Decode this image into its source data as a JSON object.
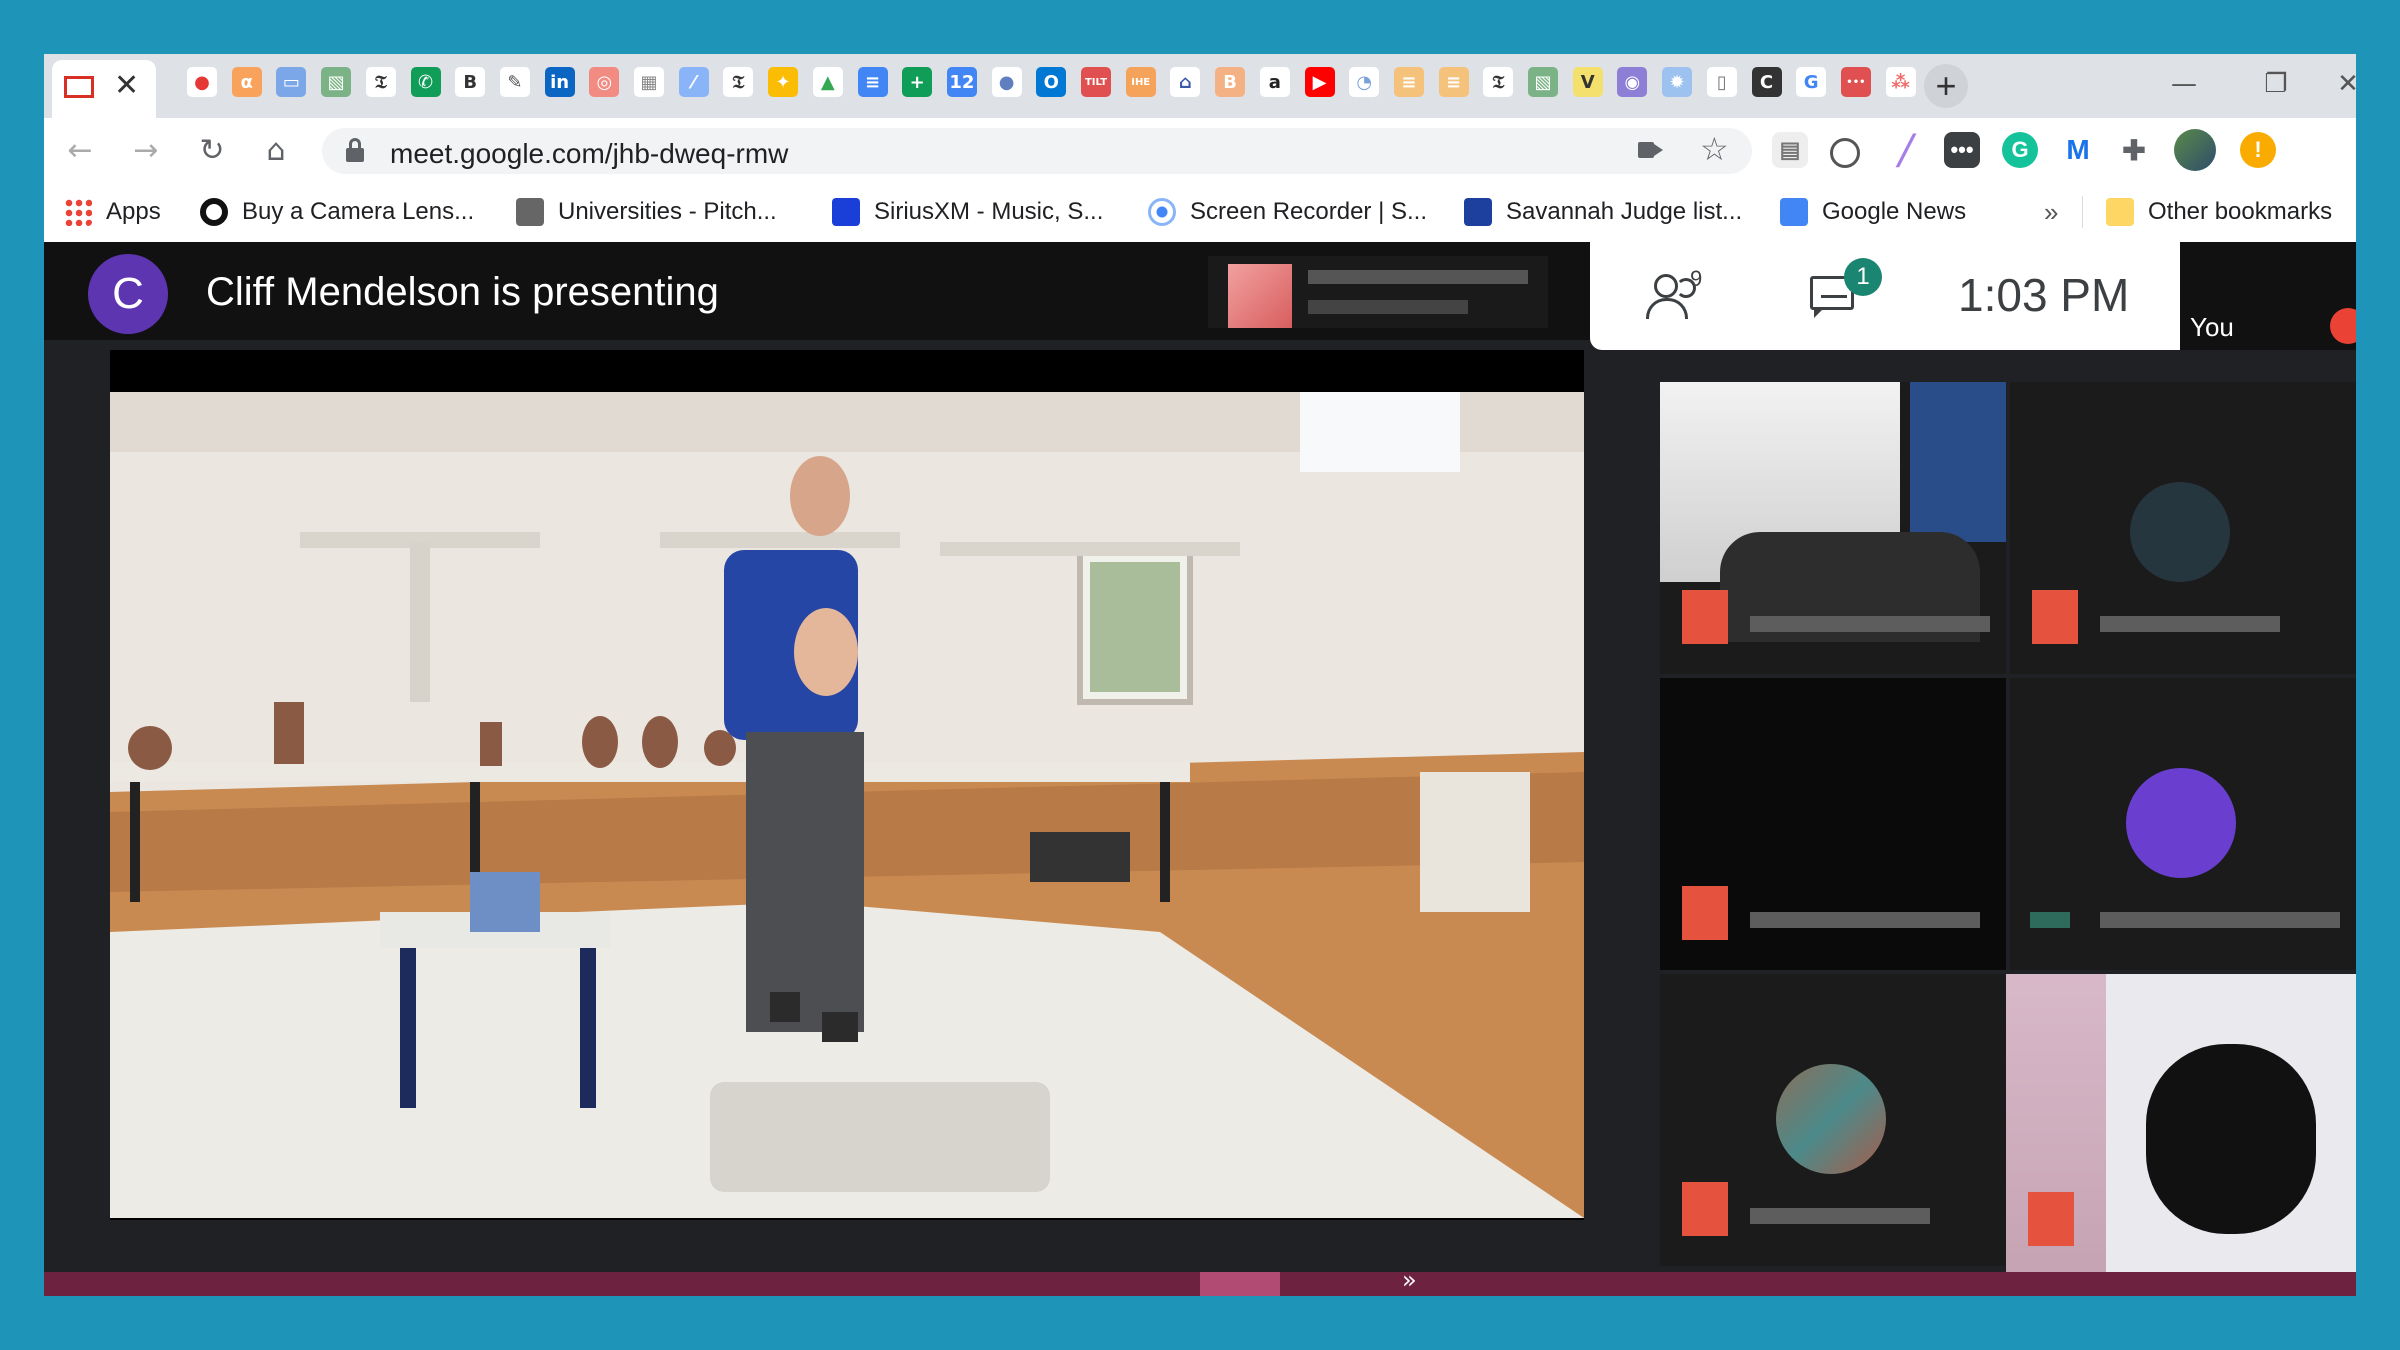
{
  "browser": {
    "tab_icons": [
      {
        "name": "gmail-icon",
        "glyph": "M",
        "color": "#ffffff",
        "fg": "#d93025"
      },
      {
        "name": "recording-icon",
        "glyph": "●",
        "color": "#ffffff",
        "fg": "#e53935"
      },
      {
        "name": "alpha-icon",
        "glyph": "α",
        "color": "#f9a25b",
        "fg": "#ffffff"
      },
      {
        "name": "chat-icon",
        "glyph": "▭",
        "color": "#7ba7e8",
        "fg": "#ffffff"
      },
      {
        "name": "photos-icon",
        "glyph": "▧",
        "color": "#7cb386",
        "fg": "#ffffff"
      },
      {
        "name": "nyt-icon",
        "glyph": "𝔗",
        "color": "#ffffff",
        "fg": "#333333"
      },
      {
        "name": "phone-icon",
        "glyph": "✆",
        "color": "#0f9d58",
        "fg": "#ffffff"
      },
      {
        "name": "bold-icon",
        "glyph": "B",
        "color": "#ffffff",
        "fg": "#333333"
      },
      {
        "name": "pin-icon",
        "glyph": "✎",
        "color": "#ffffff",
        "fg": "#555555"
      },
      {
        "name": "linkedin-icon",
        "glyph": "in",
        "color": "#0a66c2",
        "fg": "#ffffff"
      },
      {
        "name": "ad-icon",
        "glyph": "◎",
        "color": "#f28b82",
        "fg": "#ffffff"
      },
      {
        "name": "grid-icon",
        "glyph": "▦",
        "color": "#ffffff",
        "fg": "#888888"
      },
      {
        "name": "feather-icon",
        "glyph": "⁄",
        "color": "#8ab4f8",
        "fg": "#ffffff"
      },
      {
        "name": "nyt-icon-2",
        "glyph": "𝔗",
        "color": "#ffffff",
        "fg": "#333333"
      },
      {
        "name": "lightbulb-icon",
        "glyph": "✦",
        "color": "#fbbc04",
        "fg": "#ffffff"
      },
      {
        "name": "drive-icon",
        "glyph": "▲",
        "color": "#ffffff",
        "fg": "#34a853"
      },
      {
        "name": "docs-icon",
        "glyph": "≡",
        "color": "#4285f4",
        "fg": "#ffffff"
      },
      {
        "name": "plus-green-icon",
        "glyph": "+",
        "color": "#0f9d58",
        "fg": "#ffffff"
      },
      {
        "name": "calendar-icon",
        "glyph": "12",
        "color": "#4285f4",
        "fg": "#ffffff"
      },
      {
        "name": "globe-icon",
        "glyph": "●",
        "color": "#ffffff",
        "fg": "#5f7fbf"
      },
      {
        "name": "outlook-icon",
        "glyph": "O",
        "color": "#0078d4",
        "fg": "#ffffff"
      },
      {
        "name": "tilt-icon",
        "glyph": "TILT",
        "color": "#e05050",
        "fg": "#ffffff"
      },
      {
        "name": "ihe-icon",
        "glyph": "IHE",
        "color": "#f5a35b",
        "fg": "#ffffff"
      },
      {
        "name": "bank-icon",
        "glyph": "⌂",
        "color": "#ffffff",
        "fg": "#3b5ba9"
      },
      {
        "name": "bitcoin-icon",
        "glyph": "B",
        "color": "#f4b183",
        "fg": "#ffffff"
      },
      {
        "name": "amazon-icon",
        "glyph": "a",
        "color": "#ffffff",
        "fg": "#222222"
      },
      {
        "name": "youtube-icon",
        "glyph": "▶",
        "color": "#ff0000",
        "fg": "#ffffff"
      },
      {
        "name": "search-tab-icon",
        "glyph": "◔",
        "color": "#ffffff",
        "fg": "#7aa0d8"
      },
      {
        "name": "list-icon",
        "glyph": "≡",
        "color": "#f4c27a",
        "fg": "#ffffff"
      },
      {
        "name": "list-icon-2",
        "glyph": "≡",
        "color": "#f4c27a",
        "fg": "#ffffff"
      },
      {
        "name": "nyt-icon-3",
        "glyph": "𝔗",
        "color": "#ffffff",
        "fg": "#333333"
      },
      {
        "name": "photos-icon-2",
        "glyph": "▧",
        "color": "#7cb386",
        "fg": "#ffffff"
      },
      {
        "name": "v-icon",
        "glyph": "V",
        "color": "#f4e06d",
        "fg": "#333333"
      },
      {
        "name": "circle-icon",
        "glyph": "◉",
        "color": "#8d7fd6",
        "fg": "#ffffff"
      },
      {
        "name": "gear-blue-icon",
        "glyph": "✹",
        "color": "#9ec2f0",
        "fg": "#ffffff"
      },
      {
        "name": "doc-icon",
        "glyph": "▯",
        "color": "#ffffff",
        "fg": "#777777"
      },
      {
        "name": "c-icon",
        "glyph": "C",
        "color": "#333333",
        "fg": "#ffffff"
      },
      {
        "name": "google-icon",
        "glyph": "G",
        "color": "#ffffff",
        "fg": "#4285f4"
      },
      {
        "name": "dots-icon",
        "glyph": "•••",
        "color": "#e05050",
        "fg": "#ffffff"
      },
      {
        "name": "asana-icon",
        "glyph": "⁂",
        "color": "#ffffff",
        "fg": "#f06a6a"
      }
    ],
    "new_tab_label": "+",
    "url": "meet.google.com/jhb-dweq-rmw",
    "bookmarks": [
      {
        "label": "Apps",
        "icon": "apps-icon"
      },
      {
        "label": "Buy a Camera Lens...",
        "icon": "lens-icon"
      },
      {
        "label": "Universities - Pitch...",
        "icon": "university-icon"
      },
      {
        "label": "SiriusXM - Music, S...",
        "icon": "siriusxm-icon"
      },
      {
        "label": "Screen Recorder | S...",
        "icon": "recorder-icon"
      },
      {
        "label": "Savannah Judge list...",
        "icon": "judge-icon"
      },
      {
        "label": "Google News",
        "icon": "news-icon"
      },
      {
        "label": "»",
        "icon": ""
      },
      {
        "label": "Other bookmarks",
        "icon": "folder-icon"
      }
    ]
  },
  "meet": {
    "avatar_letter": "C",
    "presenting_text": "Cliff Mendelson is presenting",
    "people_count": "9",
    "chat_badge": "1",
    "time": "1:03  PM",
    "you_label": "You",
    "colors": {
      "accent": "#5e35b1",
      "badge": "#1a8570",
      "mic_off": "#e5533e",
      "bottom_bar": "#6d2240"
    }
  }
}
